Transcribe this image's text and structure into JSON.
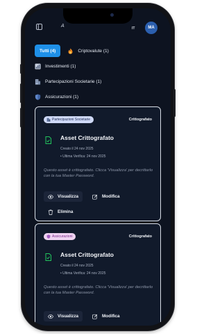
{
  "topbar": {
    "brand": "A",
    "lang": "IT",
    "avatar": "MA"
  },
  "filters": [
    {
      "label": "Tutti (4)",
      "icon": "all"
    },
    {
      "label": "Criptovalute (1)",
      "icon": "flame-icon"
    },
    {
      "label": "Investimenti (1)",
      "icon": "chart-icon"
    },
    {
      "label": "Partecipazioni Societarie (1)",
      "icon": "building-icon"
    },
    {
      "label": "Assicurazioni (1)",
      "icon": "shield-icon"
    }
  ],
  "cards": [
    {
      "category": "Partecipazioni Societarie",
      "status": "Crittografato",
      "title": "Asset Crittografato",
      "created": "Creato il 24 nov 2025",
      "updated": "• Ultima Verifica: 24 nov 2025",
      "description": "Questo asset è crittografato. Clicca 'Visualizza' per decrittarlo con la tua Master Password.",
      "view": "Visualizza",
      "edit": "Modifica",
      "delete": "Elimina"
    },
    {
      "category": "Assicurazioni",
      "status": "Crittografato",
      "title": "Asset Crittografato",
      "created": "Creato il 24 nov 2025",
      "updated": "• Ultima Verifica: 24 nov 2025",
      "description": "Questo asset è crittografato. Clicca 'Visualizza' per decrittarlo con la tua Master Password.",
      "view": "Visualizza",
      "edit": "Modifica"
    }
  ],
  "colors": {
    "accent": "#1e90e8",
    "background": "#0d1320",
    "card": "#111a2b",
    "success": "#22c55e"
  }
}
